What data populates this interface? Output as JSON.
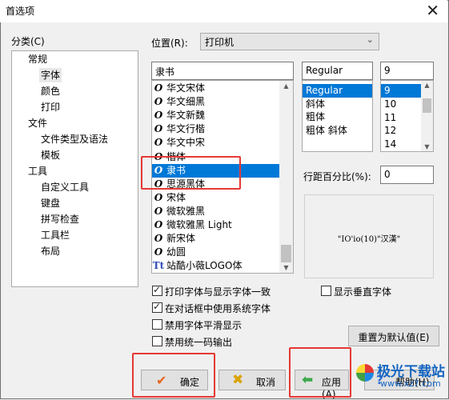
{
  "window": {
    "title": "首选项"
  },
  "category": {
    "label": "分类(C)",
    "items": [
      {
        "label": "常规",
        "level": 0,
        "selected": false
      },
      {
        "label": "字体",
        "level": 1,
        "selected": true
      },
      {
        "label": "颜色",
        "level": 1,
        "selected": false
      },
      {
        "label": "打印",
        "level": 1,
        "selected": false
      },
      {
        "label": "文件",
        "level": 0,
        "selected": false
      },
      {
        "label": "文件类型及语法",
        "level": 1,
        "selected": false
      },
      {
        "label": "模板",
        "level": 1,
        "selected": false
      },
      {
        "label": "工具",
        "level": 0,
        "selected": false
      },
      {
        "label": "自定义工具",
        "level": 1,
        "selected": false
      },
      {
        "label": "键盘",
        "level": 1,
        "selected": false
      },
      {
        "label": "拼写检查",
        "level": 1,
        "selected": false
      },
      {
        "label": "工具栏",
        "level": 1,
        "selected": false
      },
      {
        "label": "布局",
        "level": 1,
        "selected": false
      }
    ]
  },
  "location": {
    "label": "位置(R):",
    "value": "打印机"
  },
  "font": {
    "name_value": "隶书",
    "list": [
      {
        "label": "华文宋体",
        "icon": "O",
        "selected": false
      },
      {
        "label": "华文细黑",
        "icon": "O",
        "selected": false
      },
      {
        "label": "华文新魏",
        "icon": "O",
        "selected": false
      },
      {
        "label": "华文行楷",
        "icon": "O",
        "selected": false
      },
      {
        "label": "华文中宋",
        "icon": "O",
        "selected": false
      },
      {
        "label": "楷体",
        "icon": "O",
        "selected": false
      },
      {
        "label": "隶书",
        "icon": "O",
        "selected": true
      },
      {
        "label": "思源黑体",
        "icon": "O",
        "selected": false
      },
      {
        "label": "宋体",
        "icon": "O",
        "selected": false
      },
      {
        "label": "微软雅黑",
        "icon": "O",
        "selected": false
      },
      {
        "label": "微软雅黑 Light",
        "icon": "O",
        "selected": false
      },
      {
        "label": "新宋体",
        "icon": "O",
        "selected": false
      },
      {
        "label": "幼圆",
        "icon": "O",
        "selected": false
      },
      {
        "label": "站酷小薇LOGO体",
        "icon": "Tt",
        "selected": false
      }
    ],
    "style_value": "Regular",
    "styles": [
      {
        "label": "Regular",
        "selected": true
      },
      {
        "label": "斜体",
        "selected": false
      },
      {
        "label": "粗体",
        "selected": false
      },
      {
        "label": "粗体 斜体",
        "selected": false
      }
    ],
    "size_value": "9",
    "sizes": [
      {
        "label": "9",
        "selected": true
      },
      {
        "label": "10",
        "selected": false
      },
      {
        "label": "11",
        "selected": false
      },
      {
        "label": "12",
        "selected": false
      },
      {
        "label": "14",
        "selected": false
      }
    ]
  },
  "line_spacing": {
    "label": "行距百分比(%):",
    "value": "0"
  },
  "preview": {
    "text": "\"IO'io(10)\"汉漢\""
  },
  "options": {
    "print_match": {
      "label": "打印字体与显示字体一致",
      "checked": true
    },
    "show_vertical": {
      "label": "显示垂直字体",
      "checked": false
    },
    "system_font": {
      "label": "在对话框中使用系统字体",
      "checked": true
    },
    "disable_smooth": {
      "label": "禁用字体平滑显示",
      "checked": false
    },
    "disable_unicode": {
      "label": "禁用统一码输出",
      "checked": false
    }
  },
  "buttons": {
    "reset": "重置为默认值(E)",
    "ok": "确定",
    "cancel": "取消",
    "apply": "应用(A)",
    "help": "帮助(H)"
  },
  "watermark": {
    "text": "极光下载站",
    "url": "www.xz7.com"
  },
  "colors": {
    "accent": "#0078d7",
    "highlight_box": "#e53935"
  }
}
